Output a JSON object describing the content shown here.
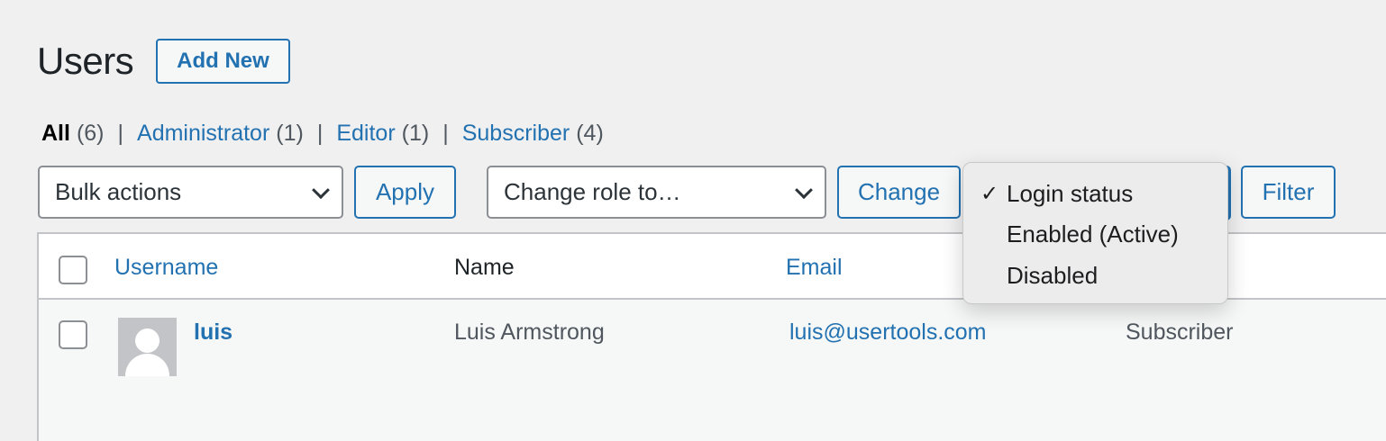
{
  "header": {
    "title": "Users",
    "add_new_label": "Add New"
  },
  "views": [
    {
      "label": "All",
      "count": "(6)",
      "current": true
    },
    {
      "label": "Administrator",
      "count": "(1)"
    },
    {
      "label": "Editor",
      "count": "(1)"
    },
    {
      "label": "Subscriber",
      "count": "(4)"
    }
  ],
  "controls": {
    "bulk_actions": "Bulk actions",
    "apply_label": "Apply",
    "change_role": "Change role to…",
    "change_label": "Change",
    "filter_label": "Filter"
  },
  "login_status_menu": {
    "options": [
      "Login status",
      "Enabled (Active)",
      "Disabled"
    ],
    "selected": "Login status"
  },
  "table": {
    "columns": [
      "Username",
      "Name",
      "Email"
    ],
    "rows": [
      {
        "username": "luis",
        "name": "Luis Armstrong",
        "email": "luis@usertools.com",
        "role": "Subscriber"
      }
    ]
  },
  "colors": {
    "accent": "#2271b1",
    "background": "#f0f0f1"
  }
}
